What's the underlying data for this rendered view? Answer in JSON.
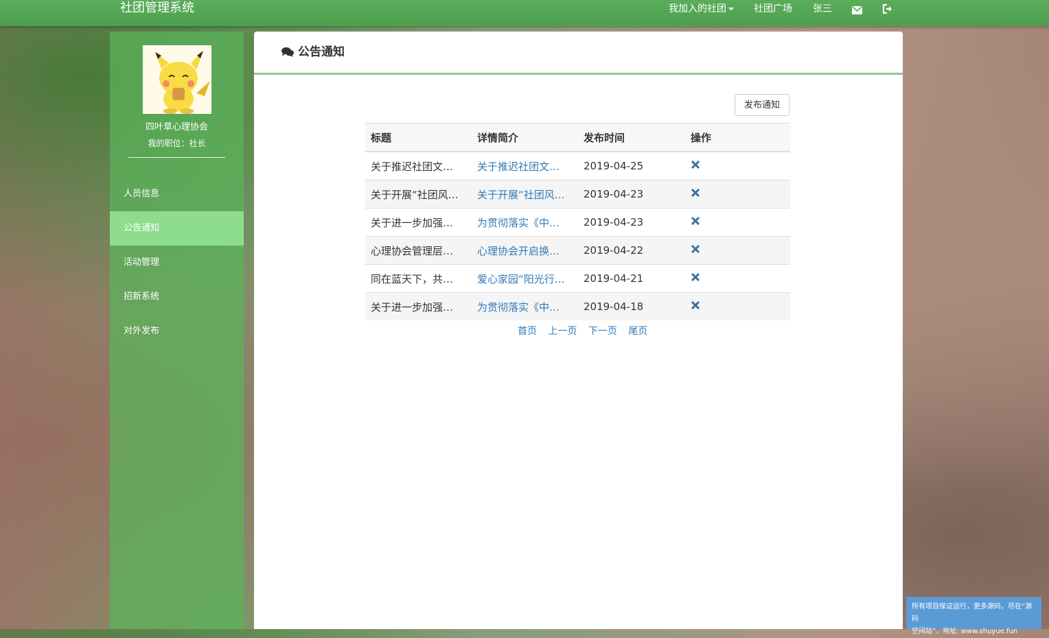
{
  "topbar": {
    "brand": "社团管理系统",
    "my_clubs": "我加入的社团",
    "plaza": "社团广场",
    "user": "张三"
  },
  "sidebar": {
    "club_name": "四叶草心理协会",
    "role": "我的职位：社长",
    "items": [
      {
        "label": "人员信息",
        "active": false
      },
      {
        "label": "公告通知",
        "active": true
      },
      {
        "label": "活动管理",
        "active": false
      },
      {
        "label": "招新系统",
        "active": false
      },
      {
        "label": "对外发布",
        "active": false
      }
    ]
  },
  "panel": {
    "title": "公告通知",
    "publish_button": "发布通知"
  },
  "table": {
    "headers": [
      "标题",
      "详情简介",
      "发布时间",
      "操作"
    ],
    "rows": [
      {
        "title": "关于推迟社团文…",
        "summary": "关于推迟社团文…",
        "date": "2019-04-25"
      },
      {
        "title": "关于开展“社团风…",
        "summary": "关于开展“社团风…",
        "date": "2019-04-23"
      },
      {
        "title": "关于进一步加强…",
        "summary": "为贯彻落实《中…",
        "date": "2019-04-23"
      },
      {
        "title": "心理协会管理层…",
        "summary": "心理协会开启换…",
        "date": "2019-04-22"
      },
      {
        "title": "同在蓝天下，共…",
        "summary": "爱心家园“阳光行…",
        "date": "2019-04-21"
      },
      {
        "title": "关于进一步加强…",
        "summary": "为贯彻落实《中…",
        "date": "2019-04-18"
      }
    ]
  },
  "pager": {
    "first": "首页",
    "prev": "上一页",
    "next": "下一页",
    "last": "尾页"
  },
  "watermark": {
    "line1": "所有项目保证运行，更多源码，尽在“源码",
    "line2": "空间站”，地址: www.shuyue.fun"
  },
  "colors": {
    "topbar": "#52a552",
    "sidebar": "#5ab45a",
    "active_item": "#96e696",
    "link": "#337ab7",
    "delete_icon": "#3a6f9a"
  }
}
